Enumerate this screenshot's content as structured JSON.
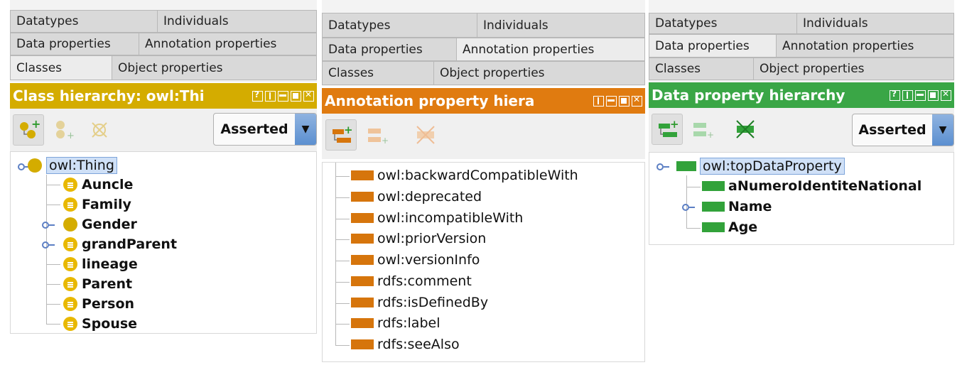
{
  "tab_labels": {
    "datatypes": "Datatypes",
    "individuals": "Individuals",
    "data_properties": "Data properties",
    "annotation_properties": "Annotation properties",
    "classes": "Classes",
    "object_properties": "Object properties"
  },
  "panels": [
    {
      "title": "Class hierarchy: owl:Thi",
      "title_color": "#d4ac00",
      "mode": "Asserted",
      "root": "owl:Thing",
      "children": [
        "Auncle",
        "Family",
        "Gender",
        "grandParent",
        "lineage",
        "Parent",
        "Person",
        "Spouse"
      ]
    },
    {
      "title": "Annotation property hiera",
      "title_color": "#e07b10",
      "items": [
        "owl:backwardCompatibleWith",
        "owl:deprecated",
        "owl:incompatibleWith",
        "owl:priorVersion",
        "owl:versionInfo",
        "rdfs:comment",
        "rdfs:isDefinedBy",
        "rdfs:label",
        "rdfs:seeAlso"
      ]
    },
    {
      "title": "Data property hierarchy",
      "title_color": "#3aa646",
      "mode": "Asserted",
      "root": "owl:topDataProperty",
      "children": [
        "aNumeroIdentiteNational",
        "Name",
        "Age"
      ]
    }
  ]
}
